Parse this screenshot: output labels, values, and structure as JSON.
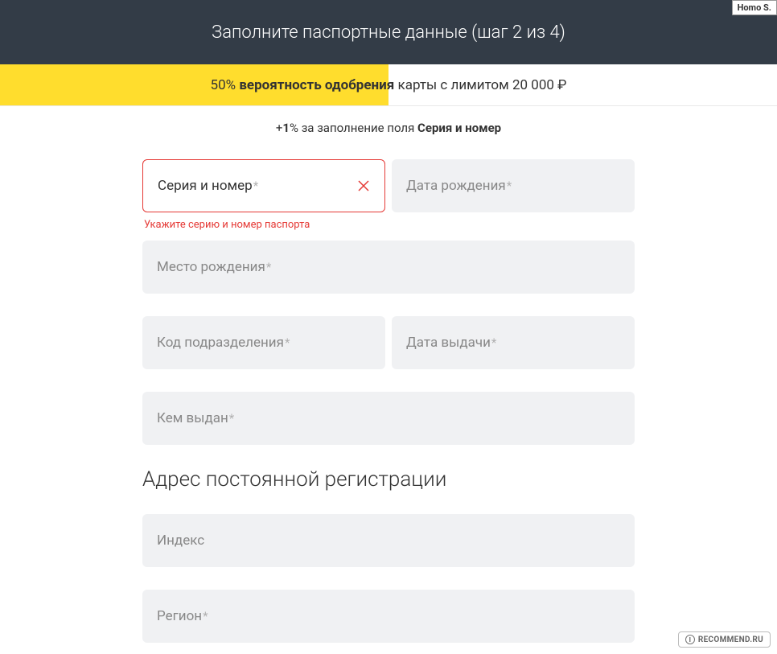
{
  "header": {
    "title": "Заполните паспортные данные (шаг 2 из 4)"
  },
  "approval": {
    "percent": "50%",
    "bold_text": "вероятность одобрения",
    "suffix": " карты с лимитом 20 000 ₽"
  },
  "bonus": {
    "plus": "+",
    "amount": "1",
    "percent_text": "% за заполнение поля ",
    "field_name": "Серия и номер"
  },
  "fields": {
    "series_number": {
      "label": "Серия и номер",
      "error": "Укажите серию и номер паспорта"
    },
    "birth_date": {
      "label": "Дата рождения"
    },
    "birth_place": {
      "label": "Место рождения"
    },
    "dept_code": {
      "label": "Код подразделения"
    },
    "issue_date": {
      "label": "Дата выдачи"
    },
    "issued_by": {
      "label": "Кем выдан"
    },
    "index": {
      "label": "Индекс"
    },
    "region": {
      "label": "Регион"
    }
  },
  "section": {
    "address_title": "Адрес постоянной регистрации"
  },
  "badges": {
    "top_right": "Homo S.",
    "bottom_right": "RECOMMEND.RU",
    "bottom_right_initial": "I"
  },
  "asterisk": "*"
}
